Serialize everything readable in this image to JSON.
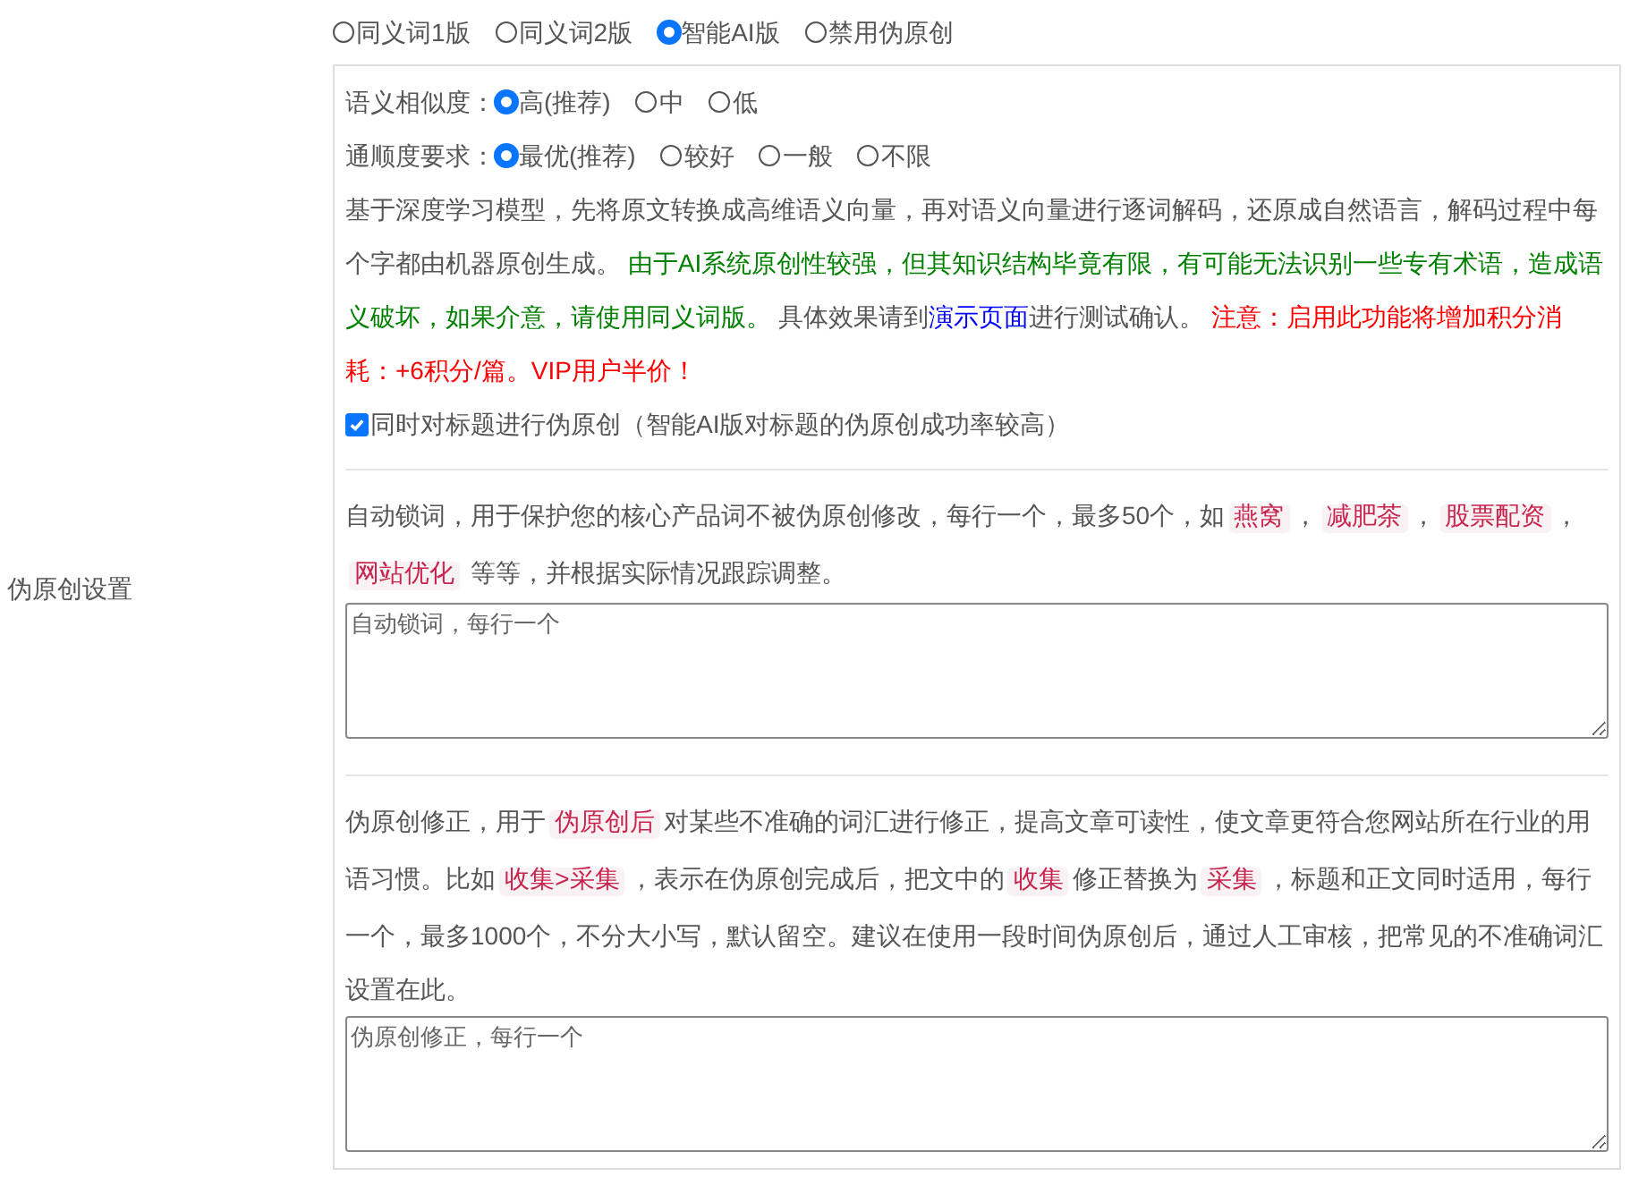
{
  "section_label": "伪原创设置",
  "modes": [
    {
      "label": "同义词1版",
      "selected": false
    },
    {
      "label": "同义词2版",
      "selected": false
    },
    {
      "label": "智能AI版",
      "selected": true
    },
    {
      "label": "禁用伪原创",
      "selected": false
    }
  ],
  "similarity": {
    "label": "语义相似度：",
    "options": [
      {
        "label": "高(推荐)",
        "selected": true
      },
      {
        "label": "中",
        "selected": false
      },
      {
        "label": "低",
        "selected": false
      }
    ]
  },
  "fluency": {
    "label": "通顺度要求：",
    "options": [
      {
        "label": "最优(推荐)",
        "selected": true
      },
      {
        "label": "较好",
        "selected": false
      },
      {
        "label": "一般",
        "selected": false
      },
      {
        "label": "不限",
        "selected": false
      }
    ]
  },
  "ai_description": [
    {
      "kind": "text",
      "text": "基于深度学习模型，先将原文转换成高维语义向量，再对语义向量进行逐词解码，还原成自然语言，解码过程中每个字都由机器原创生成。 "
    },
    {
      "kind": "notice",
      "text": "由于AI系统原创性较强，但其知识结构毕竟有限，有可能无法识别一些专有术语，造成语义破坏，如果介意，请使用同义词版。"
    },
    {
      "kind": "text",
      "text": " 具体效果请到"
    },
    {
      "kind": "link",
      "text": "演示页面"
    },
    {
      "kind": "text",
      "text": "进行测试确认。 "
    },
    {
      "kind": "warning",
      "text": "注意：启用此功能将增加积分消耗：+6积分/篇。VIP用户半价！"
    }
  ],
  "title_option": {
    "label": "同时对标题进行伪原创（智能AI版对标题的伪原创成功率较高）",
    "checked": true
  },
  "lock_words": {
    "description": [
      {
        "kind": "text",
        "text": "自动锁词，用于保护您的核心产品词不被伪原创修改，每行一个，最多50个，如"
      },
      {
        "kind": "code",
        "text": "燕窝"
      },
      {
        "kind": "text",
        "text": "，"
      },
      {
        "kind": "code",
        "text": "减肥茶"
      },
      {
        "kind": "text",
        "text": "，"
      },
      {
        "kind": "code",
        "text": "股票配资"
      },
      {
        "kind": "text",
        "text": "，"
      },
      {
        "kind": "code",
        "text": "网站优化"
      },
      {
        "kind": "text",
        "text": " 等等，并根据实际情况跟踪调整。"
      }
    ],
    "placeholder": "自动锁词，每行一个"
  },
  "corrections": {
    "description": [
      {
        "kind": "text",
        "text": "伪原创修正，用于"
      },
      {
        "kind": "code",
        "text": "伪原创后"
      },
      {
        "kind": "text",
        "text": "对某些不准确的词汇进行修正，提高文章可读性，使文章更符合您网站所在行业的用语习惯。比如"
      },
      {
        "kind": "code",
        "text": "收集>采集"
      },
      {
        "kind": "text",
        "text": "，表示在伪原创完成后，把文中的"
      },
      {
        "kind": "code",
        "text": "收集"
      },
      {
        "kind": "text",
        "text": "修正替换为"
      },
      {
        "kind": "code",
        "text": "采集"
      },
      {
        "kind": "text",
        "text": "，标题和正文同时适用，每行一个，最多1000个，不分大小写，默认留空。建议在使用一段时间伪原创后，通过人工审核，把常见的不准确词汇设置在此。"
      }
    ],
    "placeholder": "伪原创修正，每行一个"
  }
}
